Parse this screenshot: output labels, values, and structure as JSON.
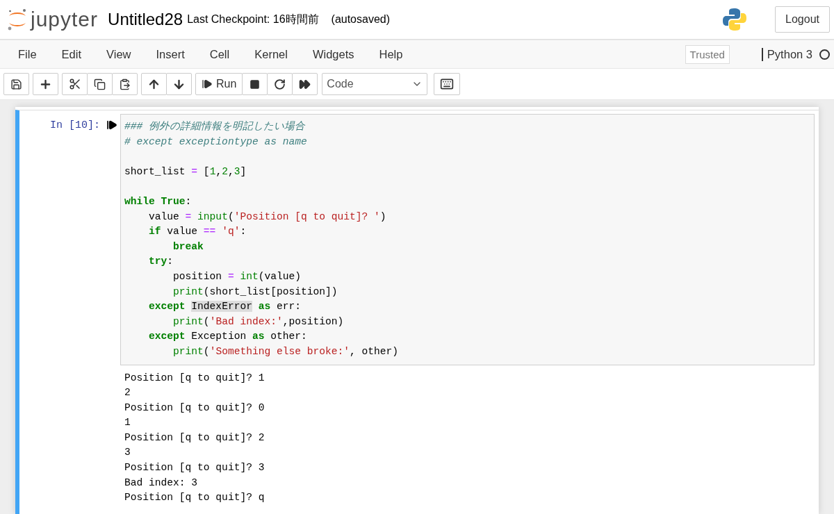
{
  "header": {
    "logo_text": "jupyter",
    "notebook_name": "Untitled28",
    "checkpoint": "Last Checkpoint: 16時間前",
    "autosave": "(autosaved)",
    "logout": "Logout"
  },
  "menu": [
    "File",
    "Edit",
    "View",
    "Insert",
    "Cell",
    "Kernel",
    "Widgets",
    "Help"
  ],
  "trusted": "Trusted",
  "kernel": {
    "name": "Python 3",
    "busy": false
  },
  "toolbar": {
    "run_label": "Run",
    "cell_type": "Code"
  },
  "cell": {
    "selected": true,
    "prompt": "In [10]:",
    "code": [
      [
        {
          "kind": "comment",
          "text": "### 例外の詳細情報を明記したい場合"
        }
      ],
      [
        {
          "kind": "comment",
          "text": "# except exceptiontype as name"
        }
      ],
      {
        "space_before": true,
        "tokens": [
          {
            "kind": "name",
            "text": "short_list "
          },
          {
            "kind": "operator",
            "text": "="
          },
          {
            "kind": "name",
            "text": " ["
          },
          {
            "kind": "number",
            "text": "1"
          },
          {
            "kind": "name",
            "text": ","
          },
          {
            "kind": "number",
            "text": "2"
          },
          {
            "kind": "name",
            "text": ","
          },
          {
            "kind": "number",
            "text": "3"
          },
          {
            "kind": "name",
            "text": "]"
          }
        ]
      },
      {
        "space_before": true,
        "tokens": [
          {
            "kind": "keyword",
            "text": "while"
          },
          {
            "kind": "keyword",
            "text": " True"
          },
          {
            "kind": "name",
            "text": ":"
          }
        ]
      },
      [
        {
          "kind": "name",
          "text": "    value "
        },
        {
          "kind": "operator",
          "text": "="
        },
        {
          "kind": "builtin",
          "text": " input"
        },
        {
          "kind": "name",
          "text": "("
        },
        {
          "kind": "string",
          "text": "'Position [q to quit]? '"
        },
        {
          "kind": "name",
          "text": ")"
        }
      ],
      [
        {
          "kind": "keyword",
          "text": "    if"
        },
        {
          "kind": "name",
          "text": " value "
        },
        {
          "kind": "operator",
          "text": "=="
        },
        {
          "kind": "string",
          "text": " 'q'"
        },
        {
          "kind": "name",
          "text": ":"
        }
      ],
      [
        {
          "kind": "keyword",
          "text": "        break"
        }
      ],
      [
        {
          "kind": "keyword",
          "text": "    try"
        },
        {
          "kind": "name",
          "text": ":"
        }
      ],
      [
        {
          "kind": "name",
          "text": "        position "
        },
        {
          "kind": "operator",
          "text": "="
        },
        {
          "kind": "builtin",
          "text": " int"
        },
        {
          "kind": "name",
          "text": "(value)"
        }
      ],
      [
        {
          "kind": "builtin",
          "text": "        print"
        },
        {
          "kind": "name",
          "text": "(short_list[position])"
        }
      ],
      [
        {
          "kind": "keyword",
          "text": "    except "
        },
        {
          "kind": "match",
          "text": "IndexError"
        },
        {
          "kind": "keyword",
          "text": " as"
        },
        {
          "kind": "name",
          "text": " err:"
        }
      ],
      [
        {
          "kind": "builtin",
          "text": "        print"
        },
        {
          "kind": "name",
          "text": "("
        },
        {
          "kind": "string",
          "text": "'Bad index:'"
        },
        {
          "kind": "name",
          "text": ",position)"
        }
      ],
      [
        {
          "kind": "keyword",
          "text": "    except"
        },
        {
          "kind": "name",
          "text": " Exception "
        },
        {
          "kind": "keyword",
          "text": "as"
        },
        {
          "kind": "name",
          "text": " other:"
        }
      ],
      [
        {
          "kind": "builtin",
          "text": "        print"
        },
        {
          "kind": "name",
          "text": "("
        },
        {
          "kind": "string",
          "text": "'Something else broke:'"
        },
        {
          "kind": "name",
          "text": ", other)"
        }
      ]
    ],
    "output": [
      "Position [q to quit]? 1",
      "2",
      "Position [q to quit]? 0",
      "1",
      "Position [q to quit]? 2",
      "3",
      "Position [q to quit]? 3",
      "Bad index: 3",
      "Position [q to quit]? q"
    ]
  }
}
